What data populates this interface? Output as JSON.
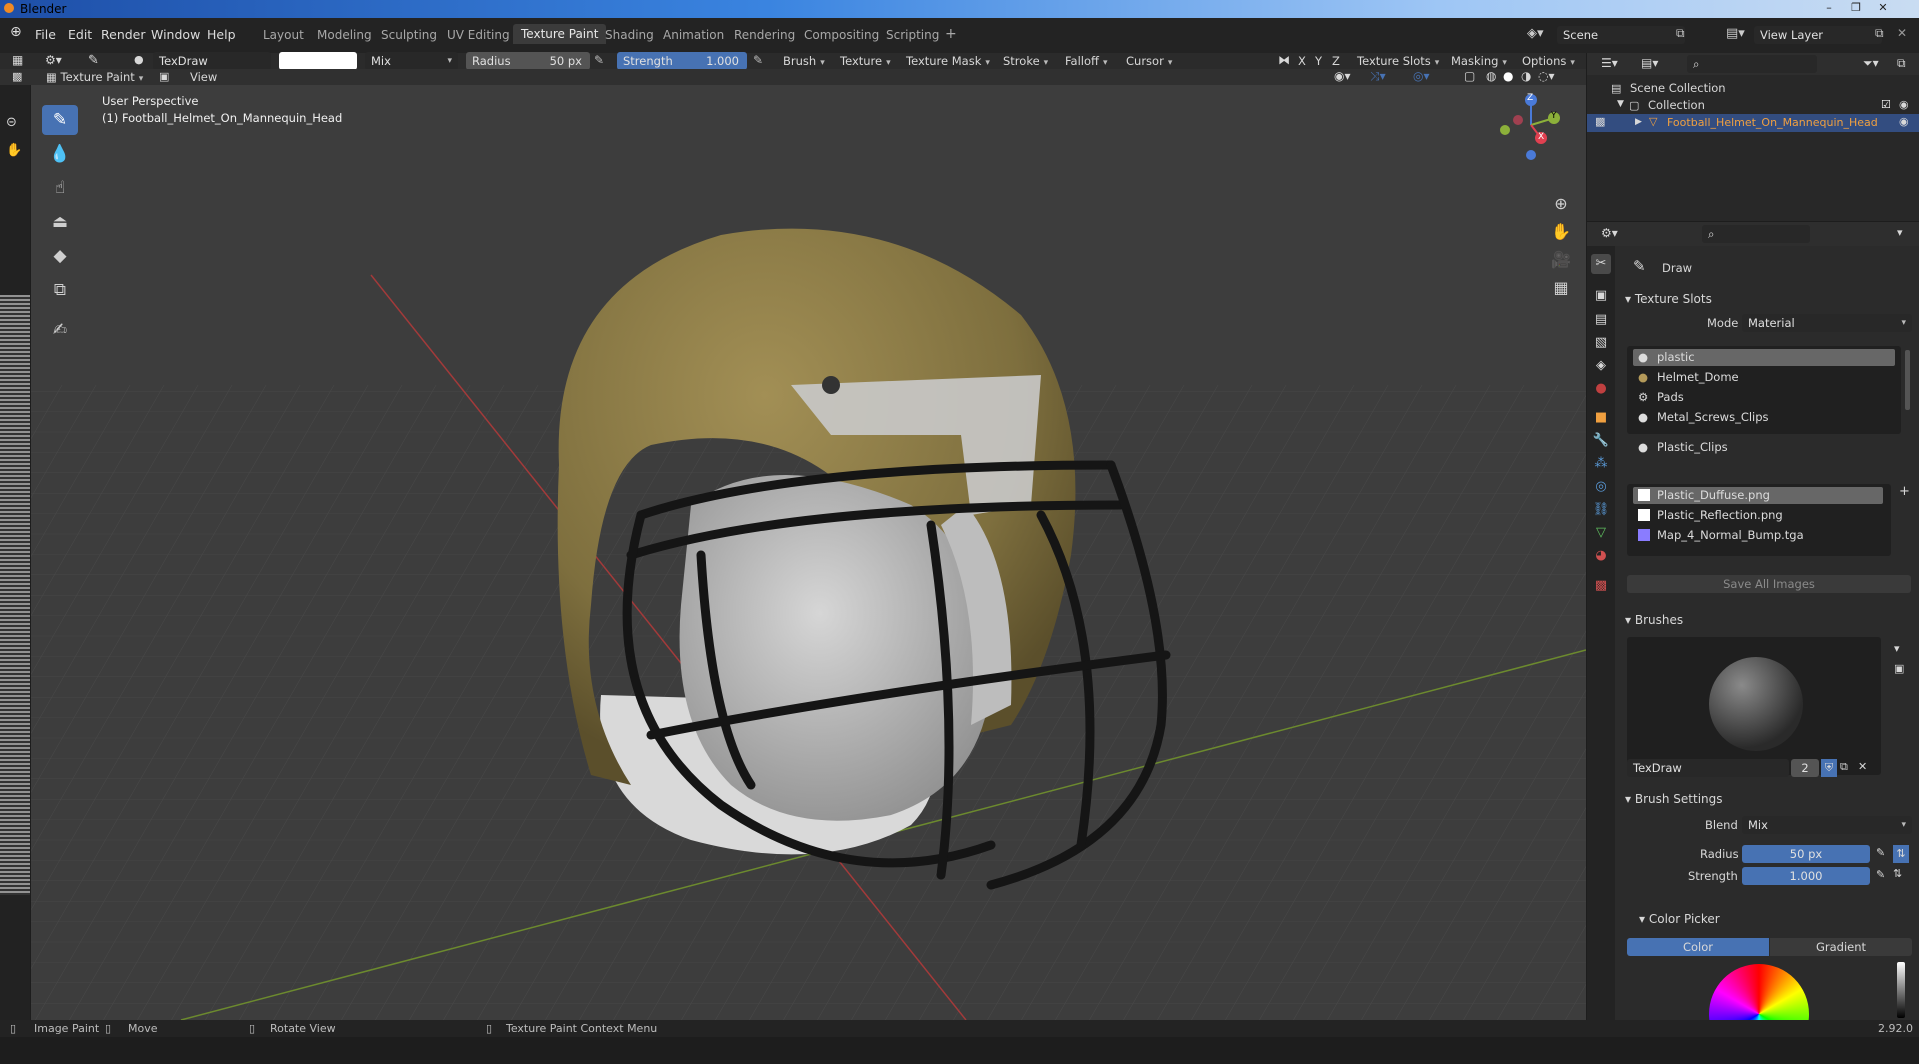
{
  "window": {
    "title": "Blender"
  },
  "menus": [
    "File",
    "Edit",
    "Render",
    "Window",
    "Help"
  ],
  "workspaces": [
    "Layout",
    "Modeling",
    "Sculpting",
    "UV Editing",
    "Texture Paint",
    "Shading",
    "Animation",
    "Rendering",
    "Compositing",
    "Scripting"
  ],
  "scene": {
    "name": "Scene",
    "view_layer": "View Layer"
  },
  "tool_header": {
    "brush_name": "TexDraw",
    "blend": "Mix",
    "radius_label": "Radius",
    "radius_value": "50 px",
    "strength_label": "Strength",
    "strength_value": "1.000",
    "menus": [
      "Brush",
      "Texture",
      "Texture Mask",
      "Stroke",
      "Falloff",
      "Cursor"
    ],
    "axes": [
      "X",
      "Y",
      "Z"
    ],
    "right_menus": [
      "Texture Slots",
      "Masking",
      "Options"
    ]
  },
  "view_header": {
    "mode": "Texture Paint",
    "view": "View"
  },
  "viewport": {
    "perspective": "User Perspective",
    "object": "(1) Football_Helmet_On_Mannequin_Head",
    "gizmo": {
      "x": "X",
      "y": "Y",
      "z": "Z"
    }
  },
  "outliner": {
    "scene_collection": "Scene Collection",
    "collection": "Collection",
    "object": "Football_Helmet_On_Mannequin_Head"
  },
  "properties": {
    "tool_name": "Draw",
    "texture_slots": {
      "title": "Texture Slots",
      "mode_label": "Mode",
      "mode_value": "Material",
      "materials": [
        "plastic",
        "Helmet_Dome",
        "Pads",
        "Metal_Screws_Clips",
        "Plastic_Clips"
      ],
      "images": [
        "Plastic_Duffuse.png",
        "Plastic_Reflection.png",
        "Map_4_Normal_Bump.tga"
      ],
      "save_all": "Save All Images"
    },
    "brushes": {
      "title": "Brushes",
      "brush_name": "TexDraw",
      "users": "2"
    },
    "brush_settings": {
      "title": "Brush Settings",
      "blend_label": "Blend",
      "blend_value": "Mix",
      "radius_label": "Radius",
      "radius_value": "50 px",
      "strength_label": "Strength",
      "strength_value": "1.000"
    },
    "color_picker": {
      "title": "Color Picker",
      "tab_color": "Color",
      "tab_gradient": "Gradient"
    }
  },
  "status": {
    "left": "Image Paint",
    "move": "Move",
    "rotate": "Rotate View",
    "context": "Texture Paint Context Menu",
    "version": "2.92.0"
  },
  "colors": {
    "accent": "#4772b3",
    "helmet": "#8a7a45",
    "viewport_bg": "#3d3d3d"
  }
}
